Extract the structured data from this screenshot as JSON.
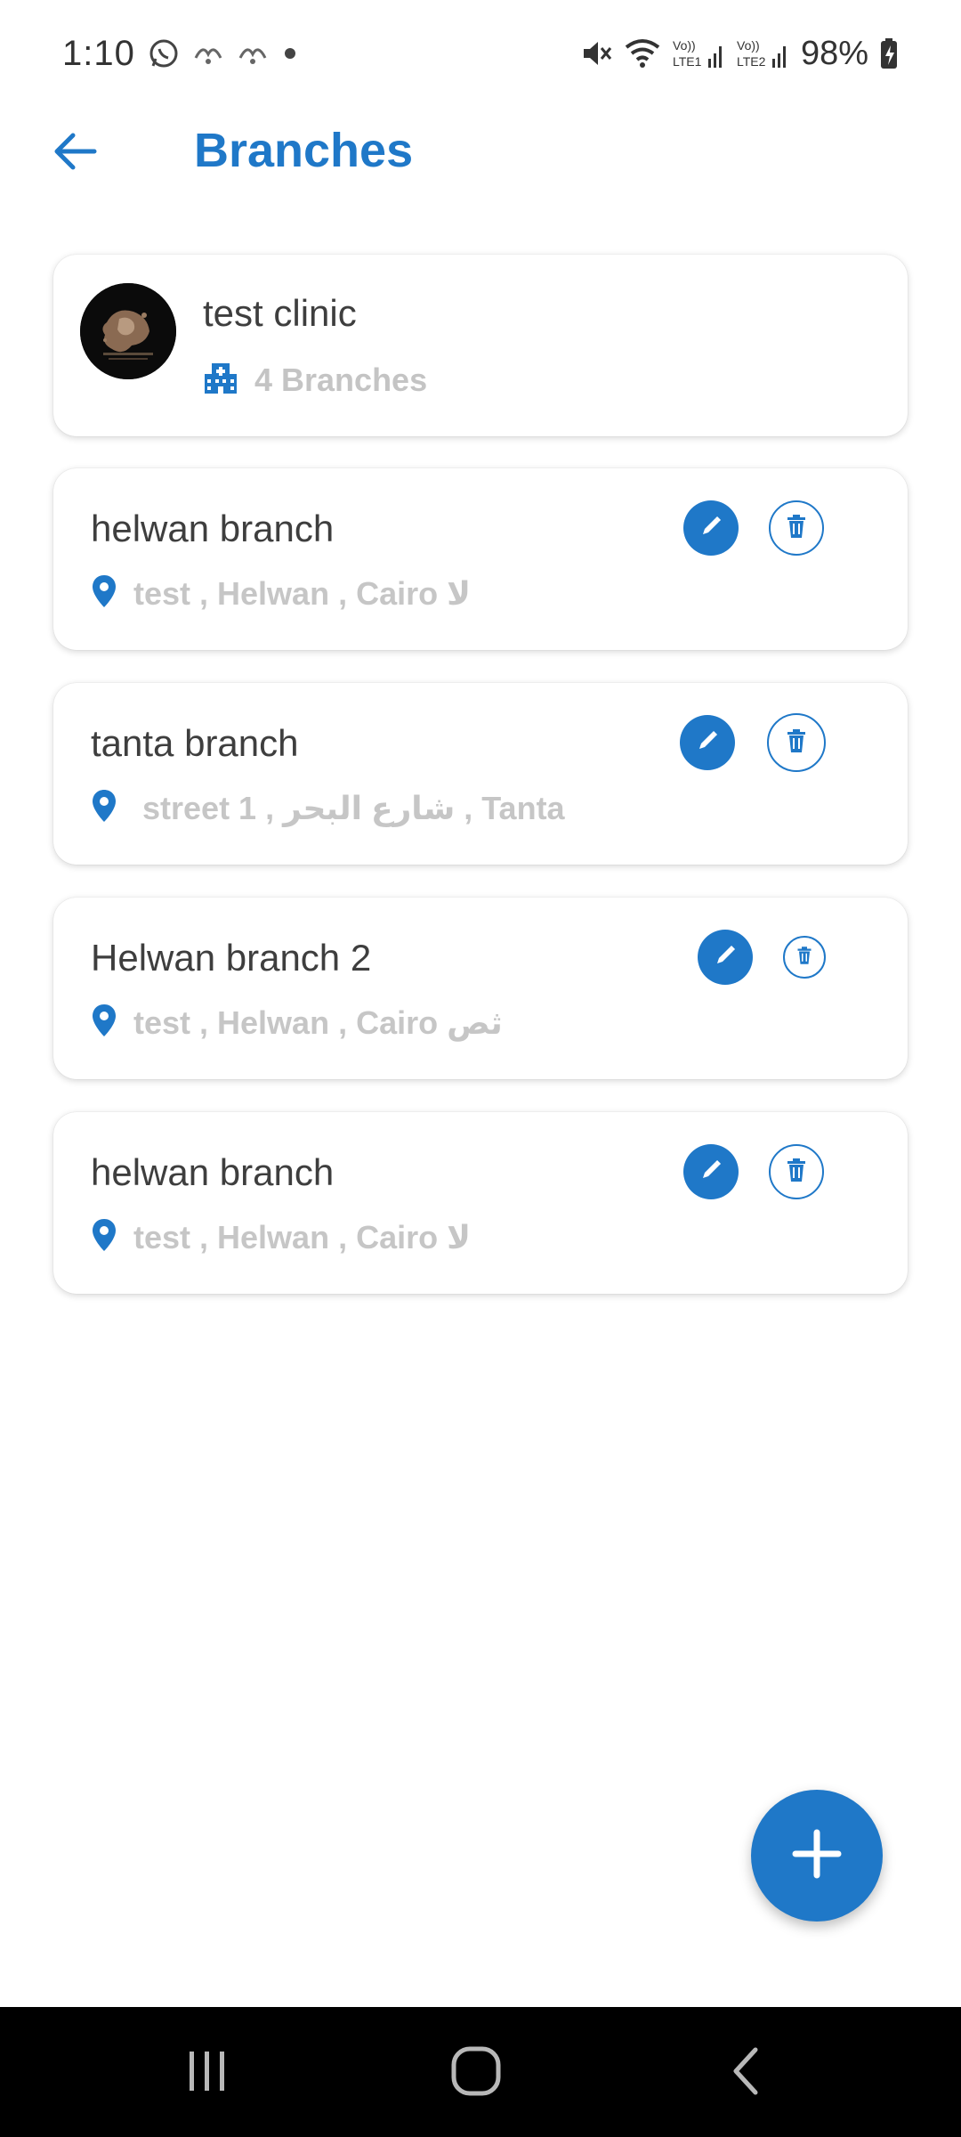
{
  "status_bar": {
    "time": "1:10",
    "battery": "98%",
    "network1": "LTE1",
    "network2": "LTE2",
    "volte": "Vo))"
  },
  "header": {
    "title": "Branches"
  },
  "clinic": {
    "name": "test clinic",
    "branch_count": "4 Branches"
  },
  "branches": [
    {
      "name": "helwan branch",
      "address": "test , Helwan , Cairo لا"
    },
    {
      "name": "tanta branch",
      "address": "street 1 , شارع البحر , Tanta"
    },
    {
      "name": "Helwan branch 2",
      "address": "test , Helwan , Cairo ثص"
    },
    {
      "name": "helwan branch",
      "address": "test , Helwan , Cairo لا"
    }
  ],
  "colors": {
    "accent": "#1f78c8",
    "muted_text": "#c6c6c6",
    "primary_text": "#3e3e3e"
  }
}
